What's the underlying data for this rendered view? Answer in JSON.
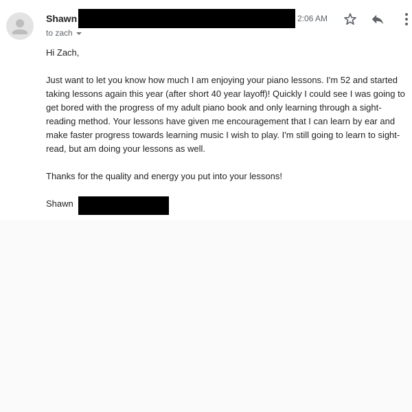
{
  "header": {
    "sender_name": "Shawn",
    "time": "2:06 AM",
    "to_line": "to zach",
    "icons": {
      "star": "star-outline-icon",
      "reply": "reply-arrow-icon",
      "more": "more-vertical-icon"
    }
  },
  "message": {
    "greeting": "Hi Zach,",
    "paragraph_1": "Just want to let you know how much I am enjoying your piano lessons.  I'm 52 and started taking lessons again this year (after short 40 year layoff)!  Quickly I could see I was going to get bored with the progress of my adult piano book and only learning through a sight-reading method.  Your lessons have given me encouragement that I can learn by ear and make faster progress towards learning music I wish to play.  I'm still going to learn to sight-read, but am doing your lessons as well.",
    "paragraph_2": "Thanks for the quality and energy you put into your lessons!",
    "signature": "Shawn"
  },
  "colors": {
    "redaction": "#000000",
    "secondary_text": "#5f6368",
    "primary_text": "#222222",
    "avatar_bg": "#e3e3e3"
  }
}
